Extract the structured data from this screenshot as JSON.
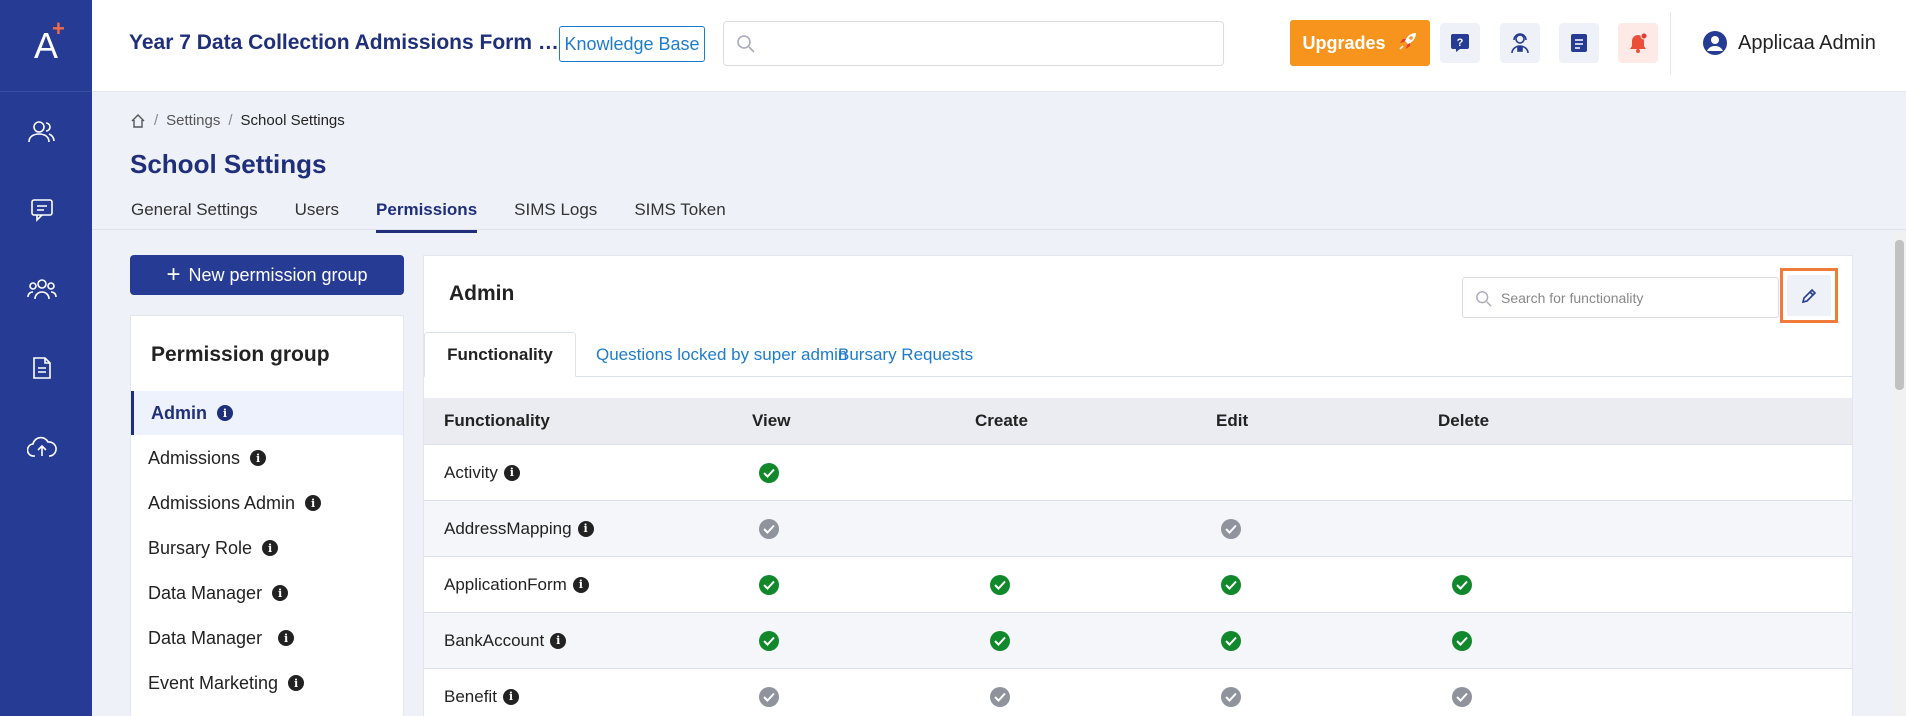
{
  "header": {
    "app_title": "Year 7 Data Collection Admissions Form …",
    "knowledge_base": "Knowledge Base",
    "search_placeholder": "",
    "upgrades": "Upgrades",
    "user_name": "Applicaa Admin"
  },
  "breadcrumb": [
    "Settings",
    "School Settings"
  ],
  "page": {
    "title": "School Settings",
    "tabs": [
      "General Settings",
      "Users",
      "Permissions",
      "SIMS Logs",
      "SIMS Token"
    ],
    "active_tab": "Permissions"
  },
  "left": {
    "new_group": "New permission group",
    "panel_title": "Permission group",
    "groups": [
      "Admin",
      "Admissions",
      "Admissions Admin",
      "Bursary Role",
      "Data Manager",
      "Data Manager",
      "Event Marketing"
    ],
    "active_group": "Admin"
  },
  "main": {
    "title": "Admin",
    "search_placeholder": "Search for functionality",
    "sub_tabs": [
      "Functionality",
      "Questions locked by super admin",
      "Bursary Requests"
    ],
    "columns": [
      "Functionality",
      "View",
      "Create",
      "Edit",
      "Delete"
    ],
    "rows": [
      {
        "name": "Activity",
        "view": "green",
        "create": "",
        "edit": "",
        "delete": ""
      },
      {
        "name": "AddressMapping",
        "view": "gray",
        "create": "",
        "edit": "gray",
        "delete": ""
      },
      {
        "name": "ApplicationForm",
        "view": "green",
        "create": "green",
        "edit": "green",
        "delete": "green"
      },
      {
        "name": "BankAccount",
        "view": "green",
        "create": "green",
        "edit": "green",
        "delete": "green"
      },
      {
        "name": "Benefit",
        "view": "gray",
        "create": "gray",
        "edit": "gray",
        "delete": "gray"
      }
    ]
  },
  "colors": {
    "brand": "#253b94",
    "accent_orange": "#f7941d",
    "check_green": "#12882c",
    "check_gray": "#8e939c"
  }
}
